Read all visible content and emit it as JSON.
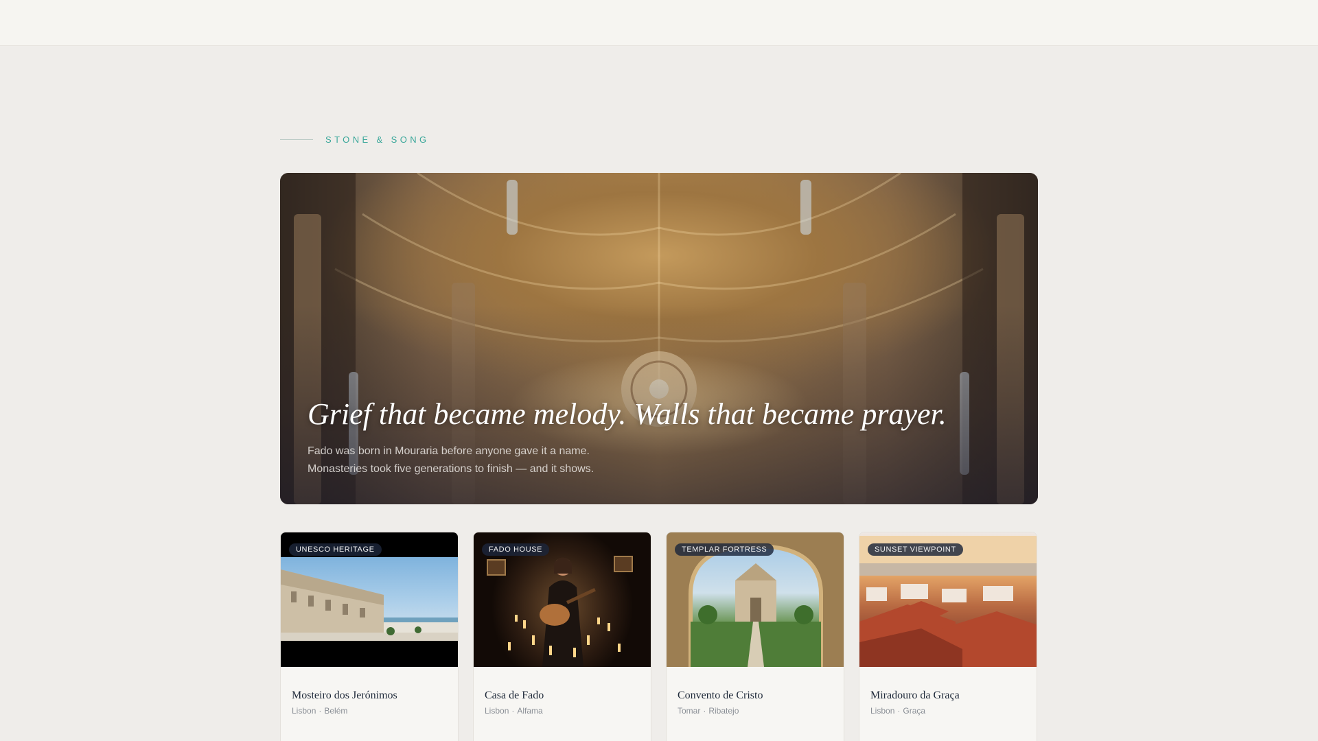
{
  "section": {
    "eyebrow": "STONE & SONG"
  },
  "hero": {
    "title": "Grief that became melody. Walls that became prayer.",
    "subtitle_line1": "Fado was born in Mouraria before anyone gave it a name.",
    "subtitle_line2": "Monasteries took five generations to finish — and it shows."
  },
  "cards": [
    {
      "badge": "UNESCO HERITAGE",
      "title": "Mosteiro dos Jerónimos",
      "city": "Lisbon",
      "area": "Belém"
    },
    {
      "badge": "FADO HOUSE",
      "title": "Casa de Fado",
      "city": "Lisbon",
      "area": "Alfama"
    },
    {
      "badge": "TEMPLAR FORTRESS",
      "title": "Convento de Cristo",
      "city": "Tomar",
      "area": "Ribatejo"
    },
    {
      "badge": "SUNSET VIEWPOINT",
      "title": "Miradouro da Graça",
      "city": "Lisbon",
      "area": "Graça"
    }
  ],
  "meta_separator": "·",
  "colors": {
    "accent": "#3aa79a",
    "badge_bg": "#1c263a",
    "page_bg": "#efedea"
  }
}
